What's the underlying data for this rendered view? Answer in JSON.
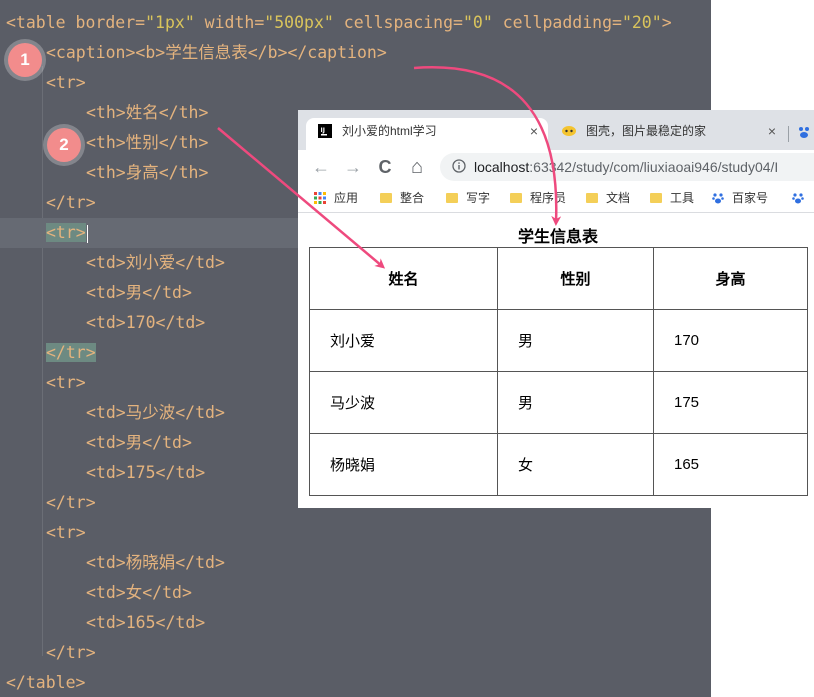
{
  "editor": {
    "lines": [
      {
        "indent": 0,
        "tokens": [
          {
            "t": "<table border=",
            "c": "txt"
          },
          {
            "t": "\"1px\"",
            "c": "str"
          },
          {
            "t": " width=",
            "c": "txt"
          },
          {
            "t": "\"500px\"",
            "c": "str"
          },
          {
            "t": " cellspacing=",
            "c": "txt"
          },
          {
            "t": "\"0\"",
            "c": "str"
          },
          {
            "t": " cellpadding=",
            "c": "txt"
          },
          {
            "t": "\"20\"",
            "c": "str"
          },
          {
            "t": ">",
            "c": "txt"
          }
        ]
      },
      {
        "indent": 1,
        "tokens": [
          {
            "t": "<caption><b>学生信息表</b></caption>",
            "c": "txt"
          }
        ]
      },
      {
        "indent": 1,
        "tokens": [
          {
            "t": "<tr>",
            "c": "txt"
          }
        ]
      },
      {
        "indent": 2,
        "tokens": [
          {
            "t": "<th>姓名</th>",
            "c": "txt"
          }
        ]
      },
      {
        "indent": 2,
        "tokens": [
          {
            "t": "<th>性别</th>",
            "c": "txt"
          }
        ]
      },
      {
        "indent": 2,
        "tokens": [
          {
            "t": "<th>身高</th>",
            "c": "txt"
          }
        ]
      },
      {
        "indent": 1,
        "tokens": [
          {
            "t": "</tr>",
            "c": "txt"
          }
        ]
      },
      {
        "indent": 1,
        "tokens": [
          {
            "t": "<tr>",
            "c": "tagbox"
          }
        ],
        "highlight": true,
        "cursor": true
      },
      {
        "indent": 2,
        "tokens": [
          {
            "t": "<td>刘小爱</td>",
            "c": "txt"
          }
        ]
      },
      {
        "indent": 2,
        "tokens": [
          {
            "t": "<td>男</td>",
            "c": "txt"
          }
        ]
      },
      {
        "indent": 2,
        "tokens": [
          {
            "t": "<td>170</td>",
            "c": "txt"
          }
        ]
      },
      {
        "indent": 1,
        "tokens": [
          {
            "t": "</tr>",
            "c": "tagbox"
          }
        ]
      },
      {
        "indent": 1,
        "tokens": [
          {
            "t": "<tr>",
            "c": "txt"
          }
        ]
      },
      {
        "indent": 2,
        "tokens": [
          {
            "t": "<td>马少波</td>",
            "c": "txt"
          }
        ]
      },
      {
        "indent": 2,
        "tokens": [
          {
            "t": "<td>男</td>",
            "c": "txt"
          }
        ]
      },
      {
        "indent": 2,
        "tokens": [
          {
            "t": "<td>175</td>",
            "c": "txt"
          }
        ]
      },
      {
        "indent": 1,
        "tokens": [
          {
            "t": "</tr>",
            "c": "txt"
          }
        ]
      },
      {
        "indent": 1,
        "tokens": [
          {
            "t": "<tr>",
            "c": "txt"
          }
        ]
      },
      {
        "indent": 2,
        "tokens": [
          {
            "t": "<td>杨晓娟</td>",
            "c": "txt"
          }
        ]
      },
      {
        "indent": 2,
        "tokens": [
          {
            "t": "<td>女</td>",
            "c": "txt"
          }
        ]
      },
      {
        "indent": 2,
        "tokens": [
          {
            "t": "<td>165</td>",
            "c": "txt"
          }
        ]
      },
      {
        "indent": 1,
        "tokens": [
          {
            "t": "</tr>",
            "c": "txt"
          }
        ]
      },
      {
        "indent": 0,
        "tokens": [
          {
            "t": "</table>",
            "c": "txt"
          }
        ]
      }
    ],
    "badges": [
      "1",
      "2"
    ],
    "colors": {
      "background": "#5a5d66",
      "tag": "#e4b37e",
      "string": "#d9c45c",
      "badge": "#f28c8c",
      "arrow": "#ee4a7e"
    }
  },
  "browser": {
    "tabs": [
      {
        "label": "刘小爱的html学习",
        "close": "×",
        "icon": "intellij-icon"
      },
      {
        "label": "图壳，图片最稳定的家",
        "close": "×",
        "icon": "tuke-icon"
      }
    ],
    "nav": {
      "back": "←",
      "forward": "→",
      "reload": "C",
      "home": "⌂"
    },
    "url": {
      "host": "localhost",
      "path": ":63342/study/com/liuxiaoai946/study04/I"
    },
    "bookmarks": [
      {
        "label": "应用",
        "icon": "apps-grid-icon"
      },
      {
        "label": "整合",
        "icon": "folder-icon"
      },
      {
        "label": "写字",
        "icon": "folder-icon"
      },
      {
        "label": "程序员",
        "icon": "folder-icon"
      },
      {
        "label": "文档",
        "icon": "folder-icon"
      },
      {
        "label": "工具",
        "icon": "folder-icon"
      },
      {
        "label": "百家号",
        "icon": "baidu-paw-icon"
      },
      {
        "label": "",
        "icon": "baidu-paw-icon"
      }
    ],
    "page": {
      "caption": "学生信息表",
      "headers": [
        "姓名",
        "性别",
        "身高"
      ],
      "rows": [
        [
          "刘小爱",
          "男",
          "170"
        ],
        [
          "马少波",
          "男",
          "175"
        ],
        [
          "杨晓娟",
          "女",
          "165"
        ]
      ]
    }
  }
}
